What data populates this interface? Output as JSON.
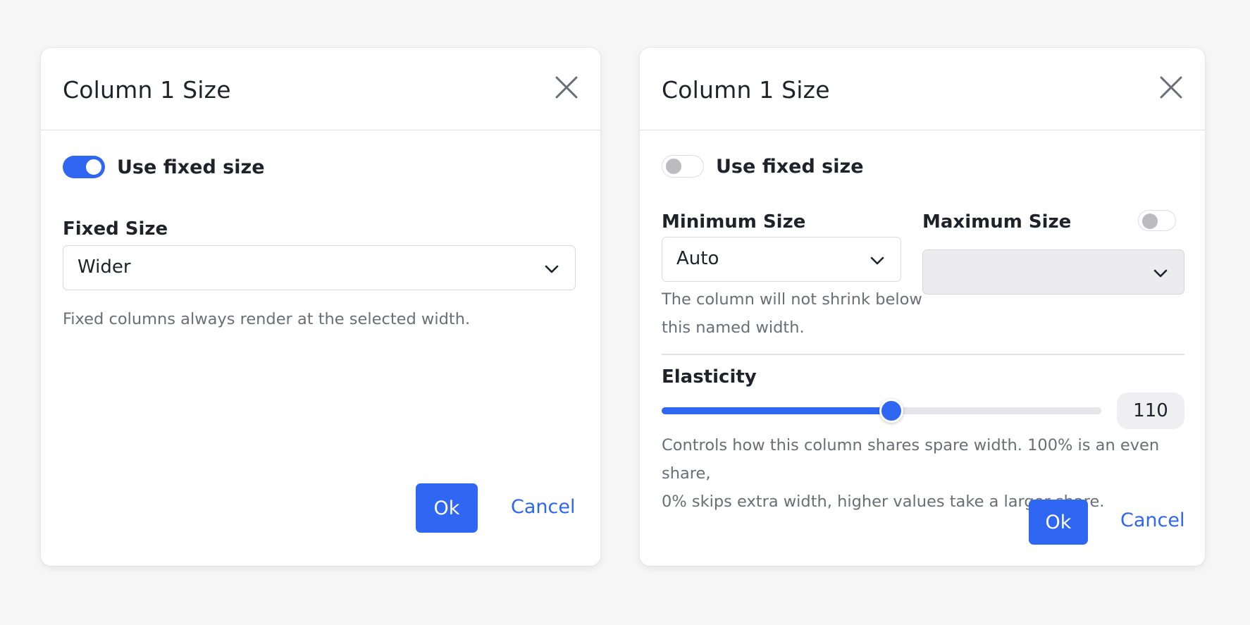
{
  "left_dialog": {
    "title": "Column 1 Size",
    "toggle": {
      "label": "Use fixed size",
      "on": true
    },
    "fixed_size": {
      "label": "Fixed Size",
      "value": "Wider"
    },
    "help": "Fixed columns always render at the selected width.",
    "ok_label": "Ok",
    "cancel_label": "Cancel"
  },
  "right_dialog": {
    "title": "Column 1 Size",
    "toggle": {
      "label": "Use fixed size",
      "on": false
    },
    "minimum_size": {
      "label": "Minimum Size",
      "value": "Auto",
      "help_line1": "The column will not shrink below",
      "help_line2": "this named width."
    },
    "maximum_size": {
      "label": "Maximum Size",
      "enabled": false,
      "value": ""
    },
    "elasticity": {
      "label": "Elasticity",
      "value": "110",
      "slider_fraction": 0.523,
      "help_line1": "Controls how this column shares spare width. 100% is an even share,",
      "help_line2": "0% skips extra width, higher values take a larger share."
    },
    "ok_label": "Ok",
    "cancel_label": "Cancel"
  },
  "colors": {
    "accent": "#2f66f2",
    "background": "#f6f6f7",
    "dialog": "#ffffff"
  },
  "icons": {
    "close": "close-icon",
    "dropdown": "chevron-down-icon"
  }
}
